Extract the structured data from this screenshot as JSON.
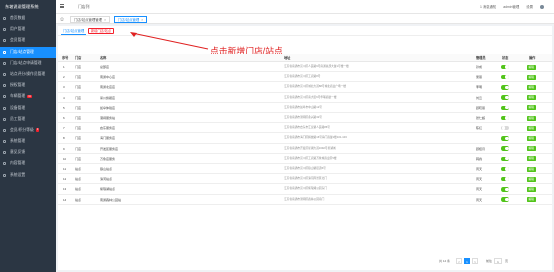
{
  "app": {
    "brand": "东坡说说管理系统"
  },
  "sidebar": {
    "items": [
      {
        "label": "首页数据"
      },
      {
        "label": "用户管理"
      },
      {
        "label": "会员管理"
      },
      {
        "label": "门店/站点管理",
        "active": true
      },
      {
        "label": "门店/站点申请管理"
      },
      {
        "label": "站点评分/操作员管理"
      },
      {
        "label": "授权管理"
      },
      {
        "label": "车辆管理",
        "badge": "11"
      },
      {
        "label": "设备管理"
      },
      {
        "label": "员工管理"
      },
      {
        "label": "会员/积分等级",
        "badge": "3"
      },
      {
        "label": "系统管理"
      },
      {
        "label": "意见反馈"
      },
      {
        "label": "内容管理"
      },
      {
        "label": "系统设置"
      }
    ]
  },
  "topbar": {
    "title": "门店列",
    "notice": "1 消息通知",
    "user": "admin管理",
    "user_menu": "设置"
  },
  "tabs": [
    {
      "label": "门店/站点管理管理"
    },
    {
      "label": "门店/站点管理",
      "active": true
    }
  ],
  "subheader": {
    "list_tab": "门店/站点管理",
    "new_button": "新增门店/站点"
  },
  "annotation": {
    "text": "点击新增门店/站点",
    "color": "#e02020"
  },
  "table": {
    "headers": [
      "序号",
      "门店",
      "名称",
      "地址",
      "管理员",
      "状态",
      "操作"
    ],
    "rows": [
      {
        "idx": "1",
        "type": "门店",
        "name": "总部店",
        "addr": "江苏省南通市崇川区人民路9号南通总部大厦1号楼一楼",
        "mgr": "孙成",
        "on": true
      },
      {
        "idx": "2",
        "type": "门店",
        "name": "南通中心店",
        "addr": "江苏省南通市崇川区工农路8号",
        "mgr": "吴丽",
        "on": true
      },
      {
        "idx": "3",
        "type": "门店",
        "name": "南通北店店",
        "addr": "江苏省南通市崇川区城北大道88号城北商业广场一楼",
        "mgr": "李明",
        "on": true
      },
      {
        "idx": "4",
        "type": "门店",
        "name": "崇川旗舰店",
        "addr": "江苏省南通市崇川区南大街6号华联商厦一楼",
        "mgr": "刘云",
        "on": true
      },
      {
        "idx": "5",
        "type": "门店",
        "name": "如皋体验店",
        "addr": "江苏省南通市如皋市中山路12号",
        "mgr": "顾晓丽",
        "on": true
      },
      {
        "idx": "6",
        "type": "门店",
        "name": "港闸服务站",
        "addr": "江苏省南通市港闸区永兴路32号",
        "mgr": "张仁超",
        "on": true
      },
      {
        "idx": "7",
        "type": "门店",
        "name": "启东服务店",
        "addr": "江苏省南通市启东市汇龙镇人民路86号",
        "mgr": "陈红",
        "on": false
      },
      {
        "idx": "8",
        "type": "门店",
        "name": "海门服务店",
        "addr": "江苏省南通市海门区解放路16号海门商厦1楼101-103",
        "mgr": "",
        "on": true
      },
      {
        "idx": "9",
        "type": "门店",
        "name": "开发区服务店",
        "addr": "江苏省南通市开发区星湖大道1692号星湖城",
        "mgr": "顾桂月",
        "on": true
      },
      {
        "idx": "10",
        "type": "门店",
        "name": "万象店服务",
        "addr": "江苏省南通市崇川区工农路万象城商业区5楼",
        "mgr": "韩霖",
        "on": true
      },
      {
        "idx": "11",
        "type": "站点",
        "name": "狼山站点",
        "addr": "江苏省南通市崇川区狼山镇街道5号",
        "mgr": "周天",
        "on": true
      },
      {
        "idx": "12",
        "type": "站点",
        "name": "濠河站点",
        "addr": "江苏省南通市崇川区濠河风景区北门",
        "mgr": "周天",
        "on": true
      },
      {
        "idx": "13",
        "type": "站点",
        "name": "紫琅湖站点",
        "addr": "江苏省南通市崇川区紫琅湖公园东门",
        "mgr": "周天",
        "on": true
      },
      {
        "idx": "14",
        "type": "站点",
        "name": "南通森林公园站",
        "addr": "江苏省南通市港闸区森林公园南门",
        "mgr": "周天",
        "on": true
      }
    ],
    "edit_label": "编辑"
  },
  "pager": {
    "total": "共 14 条",
    "pages": [
      "<",
      "1",
      ">"
    ],
    "jump": "前往",
    "page_input": "1",
    "unit": "页"
  }
}
